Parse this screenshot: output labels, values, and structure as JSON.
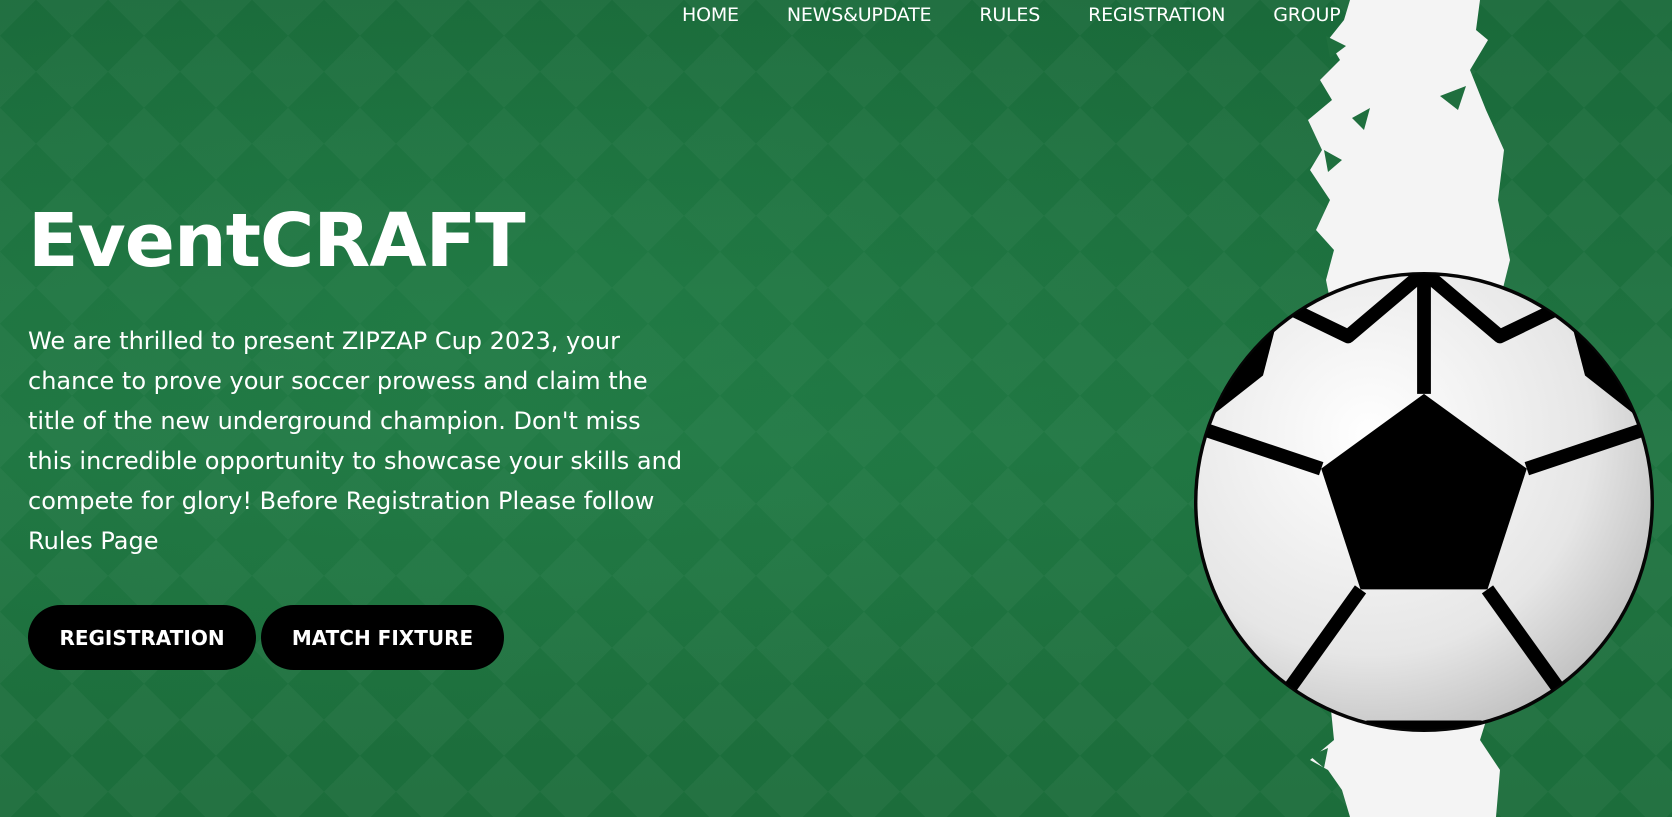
{
  "nav": {
    "items": [
      {
        "label": "HOME"
      },
      {
        "label": "NEWS&UPDATE"
      },
      {
        "label": "RULES"
      },
      {
        "label": "REGISTRATION"
      },
      {
        "label": "GROUP"
      }
    ]
  },
  "hero": {
    "title": "EventCRAFT",
    "description": "We are thrilled to present ZIPZAP Cup 2023, your chance to prove your soccer prowess and claim the title of the new underground champion. Don't miss this incredible opportunity to showcase your skills and compete for glory! Before Registration Please follow Rules Page",
    "buttons": {
      "registration_label": "REGISTRATION",
      "fixture_label": "MATCH FIXTURE"
    }
  },
  "colors": {
    "background": "#1d6b3b",
    "button": "#000000",
    "text": "#ffffff"
  },
  "icons": {
    "decoration": "soccer-ball-icon"
  }
}
